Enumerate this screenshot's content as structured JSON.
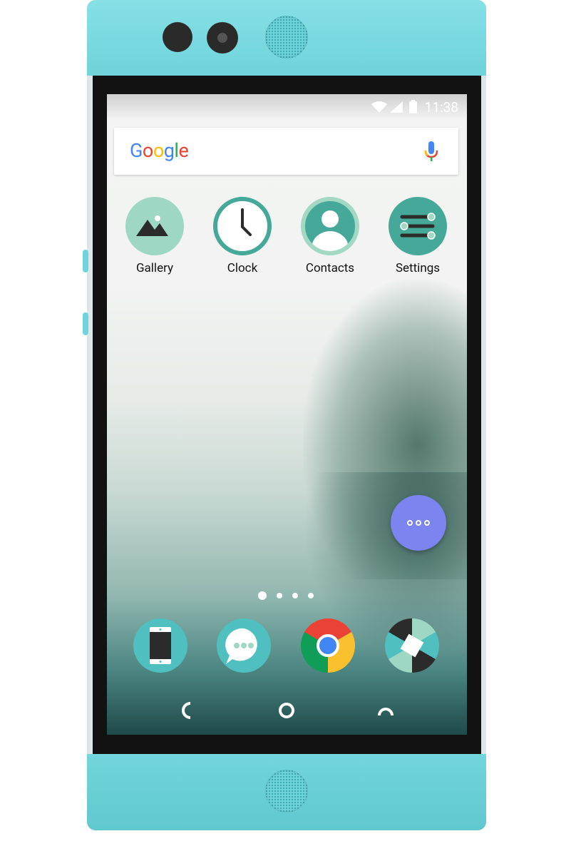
{
  "status_bar": {
    "time": "11:38",
    "icons": [
      "wifi-icon",
      "cellular-signal-icon",
      "battery-icon"
    ]
  },
  "search": {
    "logo": "Google",
    "mic_icon": "mic-icon"
  },
  "apps": [
    {
      "label": "Gallery",
      "icon": "gallery-icon"
    },
    {
      "label": "Clock",
      "icon": "clock-icon"
    },
    {
      "label": "Contacts",
      "icon": "contacts-icon"
    },
    {
      "label": "Settings",
      "icon": "settings-icon"
    }
  ],
  "page_indicator": {
    "pages": 4,
    "active": 1
  },
  "fab": {
    "icon": "more-horizontal-icon",
    "color": "#7b84ef"
  },
  "dock": [
    {
      "icon": "phone-icon"
    },
    {
      "icon": "messaging-icon"
    },
    {
      "icon": "chrome-icon"
    },
    {
      "icon": "camera-icon"
    }
  ],
  "nav": [
    "back-icon",
    "home-icon",
    "recents-icon"
  ],
  "colors": {
    "body": "#6fd3da",
    "accent": "#45a898",
    "light_accent": "#9fd7c5",
    "teal": "#4fbfbf"
  }
}
